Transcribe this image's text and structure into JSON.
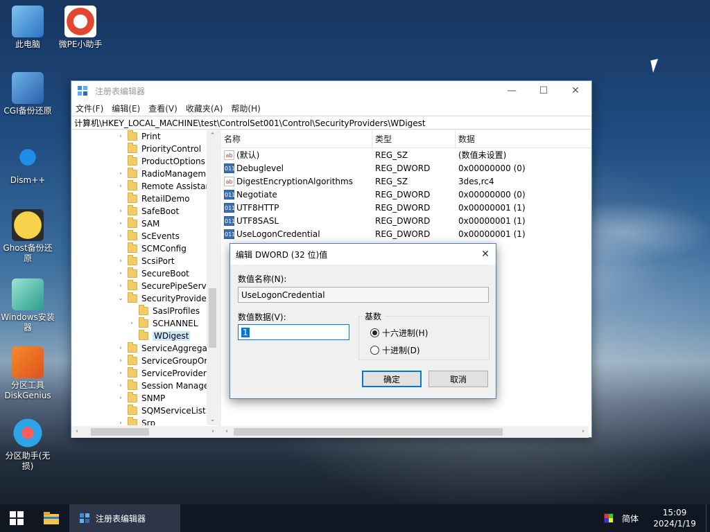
{
  "desktop_icons": [
    {
      "label": "此电脑"
    },
    {
      "label": "微PE小助手"
    },
    {
      "label": "CGI备份还原"
    },
    {
      "label": "Dism++"
    },
    {
      "label": "Ghost备份还原"
    },
    {
      "label": "Windows安装器"
    },
    {
      "label": "分区工具DiskGenius"
    },
    {
      "label": "分区助手(无损)"
    }
  ],
  "window": {
    "title": "注册表编辑器",
    "minimize": "—",
    "maximize": "☐",
    "close": "✕"
  },
  "menu": [
    "文件(F)",
    "编辑(E)",
    "查看(V)",
    "收藏夹(A)",
    "帮助(H)"
  ],
  "address": "计算机\\HKEY_LOCAL_MACHINE\\test\\ControlSet001\\Control\\SecurityProviders\\WDigest",
  "tree": [
    {
      "label": "Print",
      "arrow": "›",
      "indent": 0
    },
    {
      "label": "PriorityControl",
      "arrow": "",
      "indent": 0
    },
    {
      "label": "ProductOptions",
      "arrow": "",
      "indent": 0
    },
    {
      "label": "RadioManageme",
      "arrow": "›",
      "indent": 0
    },
    {
      "label": "Remote Assistan",
      "arrow": "›",
      "indent": 0
    },
    {
      "label": "RetailDemo",
      "arrow": "",
      "indent": 0
    },
    {
      "label": "SafeBoot",
      "arrow": "›",
      "indent": 0
    },
    {
      "label": "SAM",
      "arrow": "›",
      "indent": 0
    },
    {
      "label": "ScEvents",
      "arrow": "›",
      "indent": 0
    },
    {
      "label": "SCMConfig",
      "arrow": "",
      "indent": 0
    },
    {
      "label": "ScsiPort",
      "arrow": "›",
      "indent": 0
    },
    {
      "label": "SecureBoot",
      "arrow": "›",
      "indent": 0
    },
    {
      "label": "SecurePipeServe",
      "arrow": "›",
      "indent": 0
    },
    {
      "label": "SecurityProviders",
      "arrow": "⌄",
      "indent": 0
    },
    {
      "label": "SaslProfiles",
      "arrow": "",
      "indent": 1
    },
    {
      "label": "SCHANNEL",
      "arrow": "›",
      "indent": 1
    },
    {
      "label": "WDigest",
      "arrow": "",
      "indent": 1,
      "selected": true
    },
    {
      "label": "ServiceAggregat",
      "arrow": "›",
      "indent": 0
    },
    {
      "label": "ServiceGroupOrc",
      "arrow": "›",
      "indent": 0
    },
    {
      "label": "ServiceProvider",
      "arrow": "›",
      "indent": 0
    },
    {
      "label": "Session Manage",
      "arrow": "›",
      "indent": 0
    },
    {
      "label": "SNMP",
      "arrow": "›",
      "indent": 0
    },
    {
      "label": "SQMServiceList",
      "arrow": "",
      "indent": 0
    },
    {
      "label": "Srp",
      "arrow": "›",
      "indent": 0
    }
  ],
  "columns": {
    "name": "名称",
    "type": "类型",
    "data": "数据"
  },
  "values": [
    {
      "name": "(默认)",
      "type": "REG_SZ",
      "data": "(数值未设置)",
      "icon": "ab"
    },
    {
      "name": "Debuglevel",
      "type": "REG_DWORD",
      "data": "0x00000000 (0)",
      "icon": "dw"
    },
    {
      "name": "DigestEncryptionAlgorithms",
      "type": "REG_SZ",
      "data": "3des,rc4",
      "icon": "ab"
    },
    {
      "name": "Negotiate",
      "type": "REG_DWORD",
      "data": "0x00000000 (0)",
      "icon": "dw"
    },
    {
      "name": "UTF8HTTP",
      "type": "REG_DWORD",
      "data": "0x00000001 (1)",
      "icon": "dw"
    },
    {
      "name": "UTF8SASL",
      "type": "REG_DWORD",
      "data": "0x00000001 (1)",
      "icon": "dw"
    },
    {
      "name": "UseLogonCredential",
      "type": "REG_DWORD",
      "data": "0x00000001 (1)",
      "icon": "dw"
    }
  ],
  "dialog": {
    "title": "编辑 DWORD (32 位)值",
    "name_label": "数值名称(N):",
    "name_value": "UseLogonCredential",
    "data_label": "数值数据(V):",
    "data_value": "1",
    "base_label": "基数",
    "hex_label": "十六进制(H)",
    "dec_label": "十进制(D)",
    "ok_label": "确定",
    "cancel_label": "取消",
    "selected_base": "hex"
  },
  "taskbar": {
    "app_label": "注册表编辑器",
    "ime": "简体",
    "time": "15:09",
    "date": "2024/1/19"
  }
}
